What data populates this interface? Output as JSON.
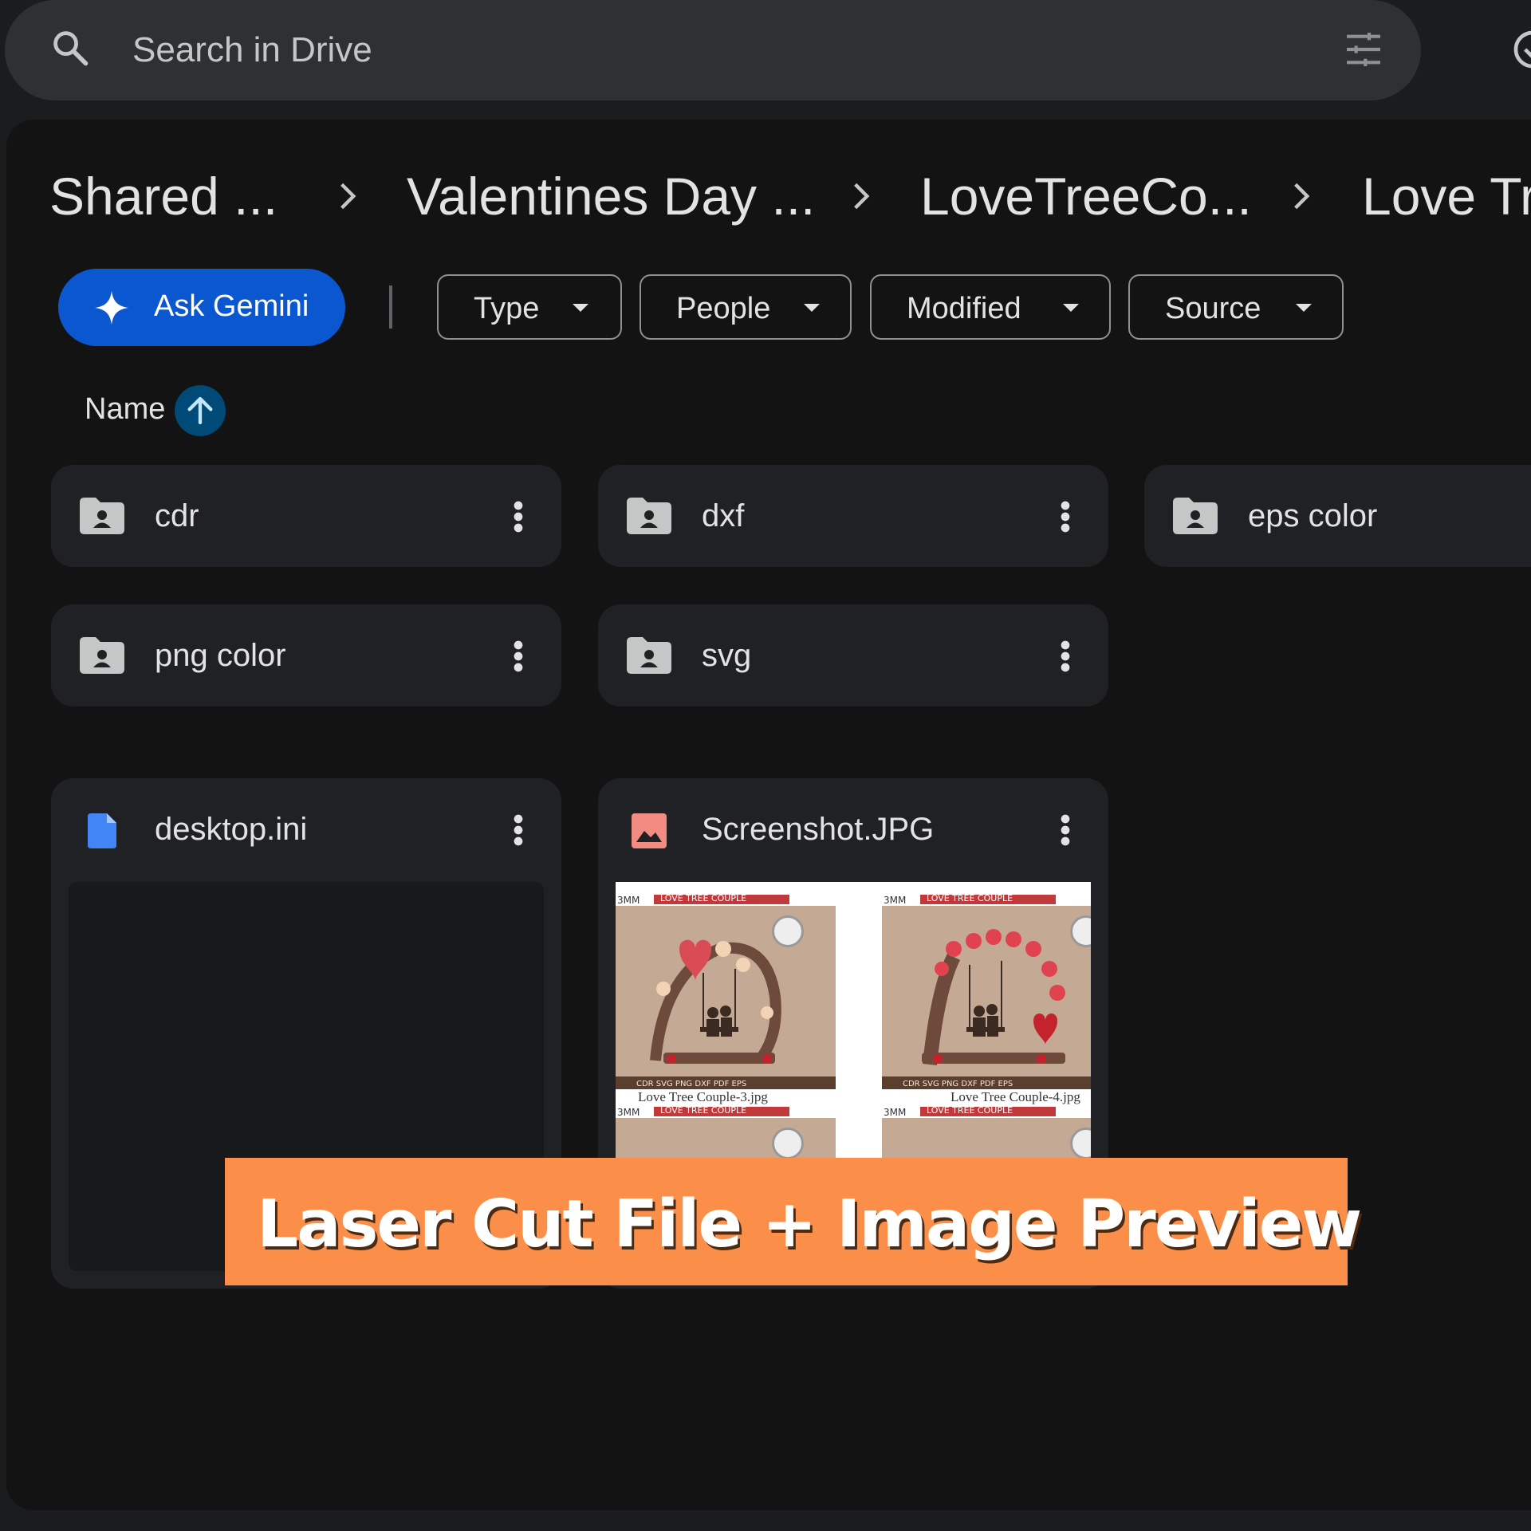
{
  "search": {
    "placeholder": "Search in Drive"
  },
  "breadcrumb": [
    {
      "label": "Shared ..."
    },
    {
      "label": "Valentines Day ..."
    },
    {
      "label": "LoveTreeCo..."
    },
    {
      "label": "Love Tre"
    }
  ],
  "toolbar": {
    "gemini_label": "Ask Gemini",
    "filters": [
      {
        "label": "Type"
      },
      {
        "label": "People"
      },
      {
        "label": "Modified"
      },
      {
        "label": "Source"
      }
    ]
  },
  "sort": {
    "label": "Name",
    "direction": "ascending"
  },
  "folders": [
    {
      "name": "cdr"
    },
    {
      "name": "dxf"
    },
    {
      "name": "eps color"
    },
    {
      "name": "png color"
    },
    {
      "name": "svg"
    }
  ],
  "files": [
    {
      "name": "desktop.ini",
      "icon": "doc-icon"
    },
    {
      "name": "Screenshot.JPG",
      "icon": "image-icon"
    }
  ],
  "preview": {
    "product_title": "LOVE TREE COUPLE",
    "thickness": "3MM",
    "formats": "CDR SVG PNG DXF PDF EPS",
    "captions": [
      "Love Tree Couple-3.jpg",
      "Love Tree Couple-4.jpg"
    ]
  },
  "banner": {
    "text": "Laser Cut File + Image Preview"
  },
  "colors": {
    "page_bg": "#1b1c1e",
    "panel_bg": "#131314",
    "card_bg": "#202124",
    "gemini_blue": "#0b57d0",
    "banner_orange": "#fb8f4a"
  }
}
